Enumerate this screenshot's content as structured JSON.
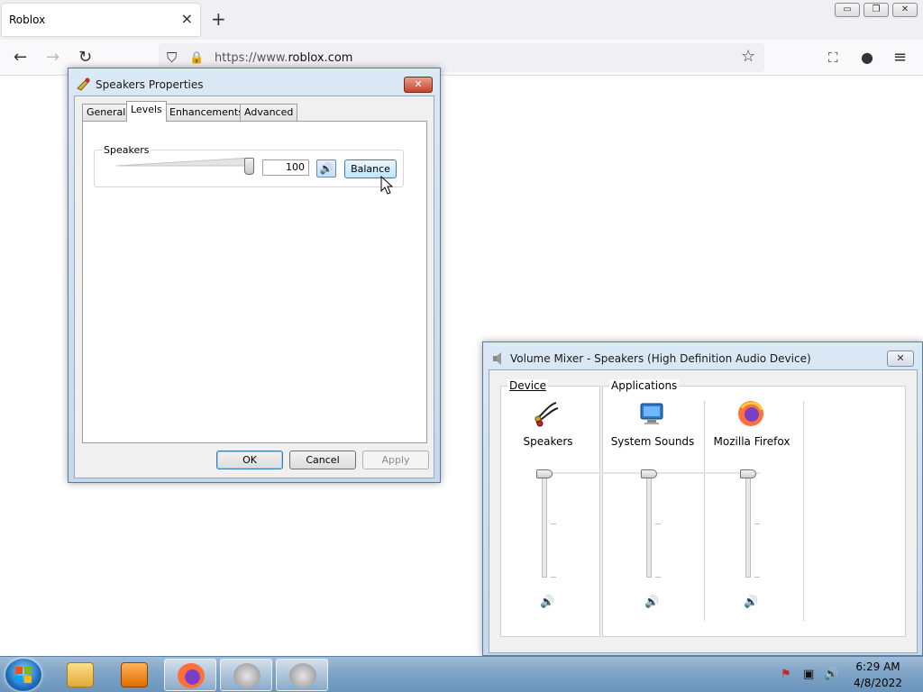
{
  "browser": {
    "tab_title": "Roblox",
    "tab_close_icon": "×",
    "new_tab_icon": "+",
    "url_prefix": "https://www.",
    "url_domain": "roblox.com",
    "window_controls": {
      "minimize": "▭",
      "restore": "❐",
      "close": "✕"
    },
    "icons": {
      "back": "←",
      "forward": "→",
      "reload": "↻",
      "shield": "⛉",
      "lock": "🔒",
      "bookmark": "☆",
      "pocket": "⛶",
      "account": "●",
      "menu": "≡"
    }
  },
  "speakers_dialog": {
    "title": "Speakers Properties",
    "close_label": "✕",
    "tabs": [
      {
        "label": "General"
      },
      {
        "label": "Levels"
      },
      {
        "label": "Enhancements"
      },
      {
        "label": "Advanced"
      }
    ],
    "active_tab": "Levels",
    "group_label": "Speakers",
    "volume_value": "100",
    "volume_level": 1.0,
    "mute_icon": "🔊",
    "balance_label": "Balance",
    "ok_label": "OK",
    "cancel_label": "Cancel",
    "apply_label": "Apply"
  },
  "mixer": {
    "title": "Volume Mixer - Speakers (High Definition Audio Device)",
    "close_label": "✕",
    "device_header": "Device",
    "applications_header": "Applications",
    "channels": [
      {
        "label": "Speakers",
        "icon": "speakers-icon",
        "level": 1.0,
        "mute_icon": "🔊"
      },
      {
        "label": "System Sounds",
        "icon": "system-sounds-icon",
        "level": 1.0,
        "mute_icon": "🔊"
      },
      {
        "label": "Mozilla Firefox",
        "icon": "firefox-icon",
        "level": 1.0,
        "mute_icon": "🔊"
      }
    ]
  },
  "taskbar": {
    "time": "6:29 AM",
    "date": "4/8/2022",
    "tray_icons": {
      "flag": "⚑",
      "network": "▣",
      "volume": "🔊"
    }
  },
  "colors": {
    "win7_frame": "#c7dbef",
    "accent_blue": "#1b5fa8",
    "firefox_orange": "#ff7139",
    "taskbar": "#7fa4c6"
  }
}
